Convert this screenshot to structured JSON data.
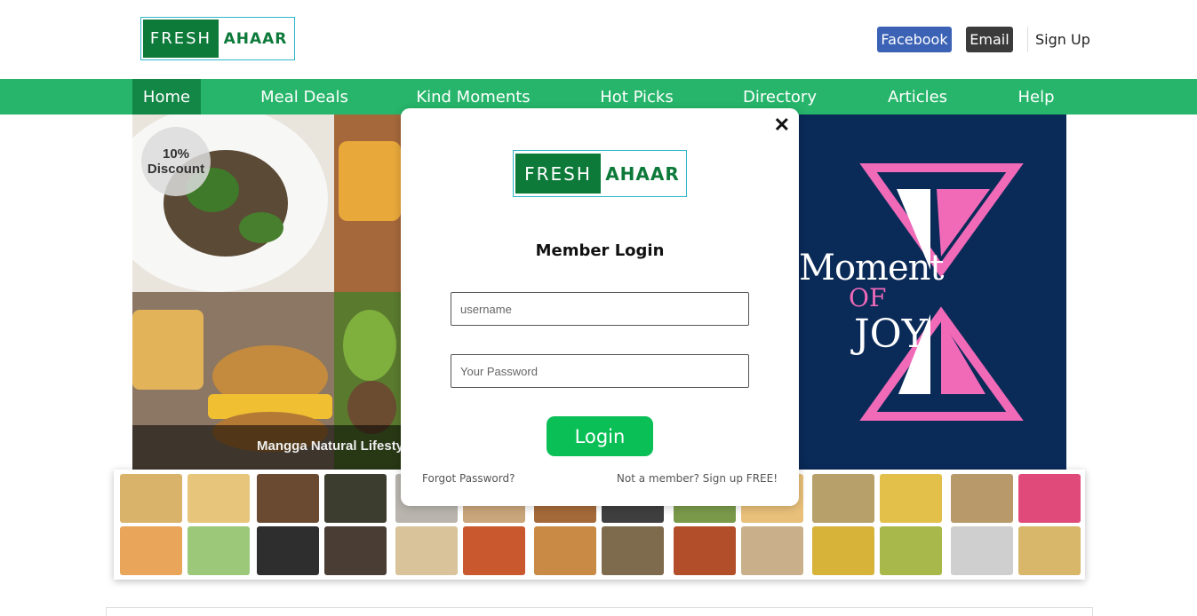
{
  "header": {
    "logo": {
      "left": "FRESH",
      "right": "AHAAR"
    },
    "facebook_label": "Facebook",
    "email_label": "Email",
    "signup_label": "Sign Up"
  },
  "nav": {
    "items": [
      {
        "label": "Home",
        "active": true
      },
      {
        "label": "Meal Deals",
        "active": false
      },
      {
        "label": "Kind Moments",
        "active": false
      },
      {
        "label": "Hot Picks",
        "active": false
      },
      {
        "label": "Directory",
        "active": false
      },
      {
        "label": "Articles",
        "active": false
      },
      {
        "label": "Help",
        "active": false
      }
    ]
  },
  "hero": {
    "discount_line1": "10%",
    "discount_line2": "Discount",
    "caption": "Mangga Natural Lifestyl",
    "banner": {
      "line1": "Moment",
      "line2": "OF",
      "line3": "JOY"
    }
  },
  "modal": {
    "logo": {
      "left": "FRESH",
      "right": "AHAAR"
    },
    "close_symbol": "✕",
    "title": "Member Login",
    "username_placeholder": "username",
    "password_placeholder": "Your Password",
    "login_label": "Login",
    "forgot_label": "Forgot Password?",
    "signup_label": "Not a member? Sign up FREE!"
  },
  "colors": {
    "nav_green": "#26b56a",
    "nav_active": "#138746",
    "brand_green": "#0d7a3a",
    "login_green": "#0bbf57",
    "facebook_blue": "#3b62b5",
    "banner_navy": "#0a2a58",
    "banner_pink": "#f06ab8"
  }
}
